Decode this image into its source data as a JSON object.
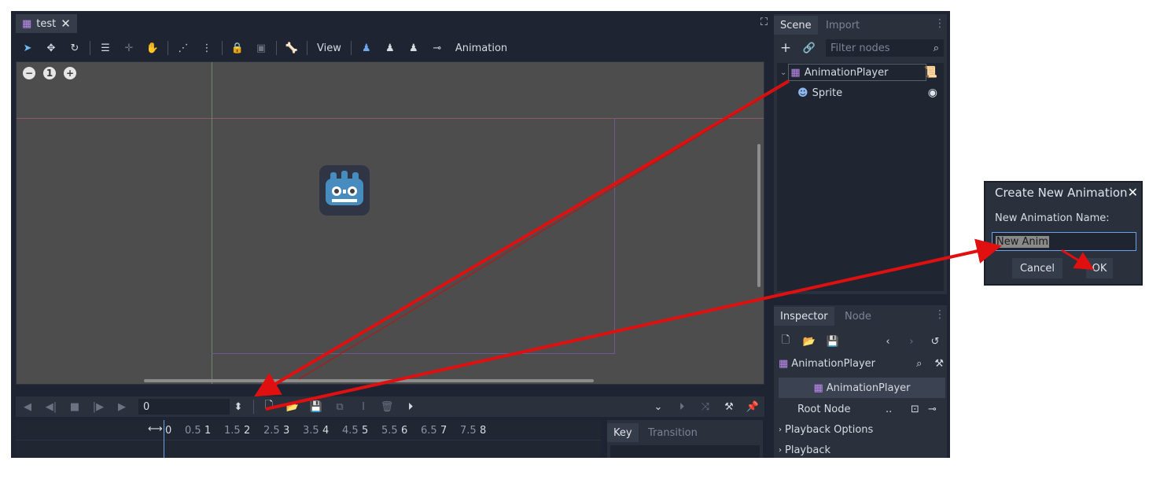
{
  "colors": {
    "accent": "#70bafa",
    "arrow": "#e01010",
    "viewport_bg": "#4d4d4d",
    "panel_bg": "#2a303c"
  },
  "tab": {
    "label": "test",
    "close": "✕"
  },
  "toolbar2d": {
    "view_label": "View",
    "animation_label": "Animation"
  },
  "zoom": {
    "minus": "−",
    "reset": "1",
    "plus": "+"
  },
  "animation": {
    "time_value": "0",
    "ruler_ticks": [
      "0",
      "0.5",
      "1",
      "1.5",
      "2",
      "2.5",
      "3",
      "3.5",
      "4",
      "4.5",
      "5",
      "5.5",
      "6",
      "6.5",
      "7",
      "7.5",
      "8"
    ],
    "tabs": {
      "key": "Key",
      "transition": "Transition"
    }
  },
  "scene_dock": {
    "tabs": {
      "scene": "Scene",
      "import": "Import"
    },
    "filter_placeholder": "Filter nodes",
    "nodes": {
      "root": "AnimationPlayer",
      "child": "Sprite"
    }
  },
  "inspector": {
    "tabs": {
      "inspector": "Inspector",
      "node": "Node"
    },
    "path_node": "AnimationPlayer",
    "header": "AnimationPlayer",
    "root_node_label": "Root Node",
    "root_node_value": "..",
    "sections": {
      "playback_options": "Playback Options",
      "playback": "Playback"
    }
  },
  "dialog": {
    "title": "Create New Animation",
    "label": "New Animation Name:",
    "input_value": "New Anim",
    "cancel": "Cancel",
    "ok": "OK"
  }
}
